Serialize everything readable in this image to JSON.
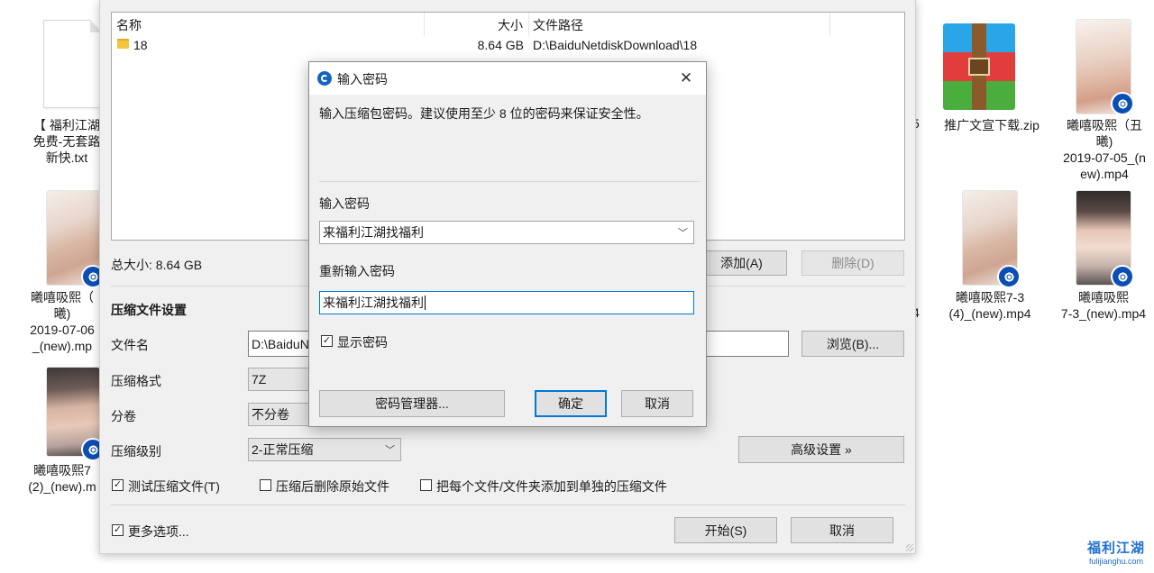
{
  "desktop": {
    "left_items": [
      {
        "label_lines": [
          "【 福利江湖",
          "免费-无套路",
          "新快.txt"
        ]
      },
      {
        "label_lines": [
          "曦嘻吸熙（",
          "曦)",
          "2019-07-06",
          "_(new).mp"
        ]
      },
      {
        "label_lines": [
          "曦嘻吸熙7",
          "(2)_(new).m"
        ]
      }
    ],
    "right_items": [
      {
        "label_lines": [
          "推广文宣下载.zip"
        ]
      },
      {
        "label_lines": [
          "曦嘻吸熙（丑",
          "曦)",
          "2019-07-05_(n",
          "ew).mp4"
        ]
      },
      {
        "label_lines": [
          "曦嘻吸熙7-3",
          "(4)_(new).mp4"
        ]
      },
      {
        "label_lines": [
          "曦嘻吸熙",
          "7-3_(new).mp4"
        ]
      }
    ],
    "partial_digits": [
      "5",
      "4"
    ],
    "watermark": {
      "brand": "福利江湖",
      "site": "fulijianghu.com"
    }
  },
  "main_window": {
    "file_list": {
      "columns": [
        "名称",
        "大小",
        "文件路径"
      ],
      "rows": [
        {
          "name": "18",
          "size": "8.64 GB",
          "path": "D:\\BaiduNetdiskDownload\\18"
        }
      ]
    },
    "total_size": "总大小: 8.64 GB",
    "add_button": "添加(A)",
    "delete_button": "删除(D)",
    "settings_title": "压缩文件设置",
    "filename_label": "文件名",
    "filename_value": "D:\\BaiduNe",
    "browse_button": "浏览(B)...",
    "format_label": "压缩格式",
    "format_value": "7Z",
    "volume_label": "分卷",
    "volume_value": "不分卷",
    "level_label": "压缩级别",
    "level_value": "2-正常压缩",
    "advanced_button": "高级设置 »",
    "test_archive": {
      "label": "测试压缩文件(T)",
      "checked": true
    },
    "delete_source": {
      "label": "压缩后删除原始文件",
      "checked": false
    },
    "separate_archives": {
      "label": "把每个文件/文件夹添加到单独的压缩文件",
      "checked": false
    },
    "more_options": {
      "label": "更多选项...",
      "checked": true
    },
    "start_button": "开始(S)",
    "cancel_button": "取消"
  },
  "password_dialog": {
    "title": "输入密码",
    "description": "输入压缩包密码。建议使用至少 8 位的密码来保证安全性。",
    "password_label": "输入密码",
    "password_value": "来福利江湖找福利",
    "confirm_label": "重新输入密码",
    "confirm_value": "来福利江湖找福利",
    "show_password": {
      "label": "显示密码",
      "checked": true
    },
    "manager_button": "密码管理器...",
    "ok_button": "确定",
    "cancel_button": "取消",
    "close_glyph": "✕"
  }
}
